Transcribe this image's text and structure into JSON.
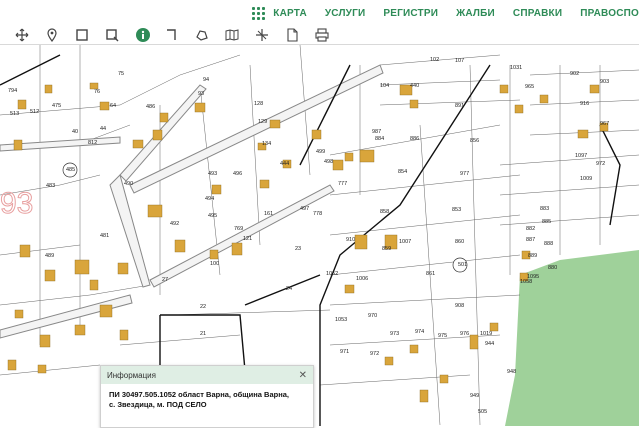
{
  "nav": {
    "items": [
      "КАРТА",
      "УСЛУГИ",
      "РЕГИСТРИ",
      "ЖАЛБИ",
      "СПРАВКИ",
      "ПРАВОСПО"
    ]
  },
  "toolbar": {
    "tools": [
      "move-icon",
      "pin-icon",
      "select-rect-icon",
      "select-poly-icon",
      "info-icon",
      "measure-angle-icon",
      "polygon-icon",
      "map-icon",
      "split-icon",
      "document-icon",
      "print-icon"
    ]
  },
  "map": {
    "parcel_labels": [
      "794",
      "475",
      "513",
      "512",
      "812",
      "40",
      "44",
      "75",
      "76",
      "64",
      "486",
      "93",
      "94",
      "128",
      "129",
      "134",
      "1031",
      "102",
      "107",
      "104",
      "440",
      "903",
      "902",
      "965",
      "916",
      "967",
      "891",
      "1097",
      "856",
      "854",
      "977",
      "858",
      "853",
      "859",
      "860",
      "861",
      "908",
      "910",
      "1007",
      "1006",
      "1052",
      "1053",
      "970",
      "971",
      "972",
      "973",
      "974",
      "975",
      "976",
      "1019",
      "944",
      "948",
      "949",
      "505",
      "501",
      "485",
      "483",
      "481",
      "489",
      "490",
      "492",
      "493",
      "494",
      "495",
      "496",
      "497",
      "498",
      "499",
      "444",
      "161",
      "769",
      "121",
      "100",
      "27",
      "22",
      "21",
      "23",
      "24",
      "778",
      "777",
      "987",
      "884",
      "886",
      "882",
      "883",
      "885",
      "887",
      "888",
      "889",
      "880",
      "1095",
      "1058",
      "1009",
      "972"
    ],
    "brand_colors": {
      "nav": "#2e8b57",
      "park": "#9fd19a",
      "building": "#d9a53b"
    }
  },
  "popup": {
    "title": "Информация",
    "line1": "ПИ 30497.505.1052 област Варна, община Варна,",
    "line2": "с. Звездица, м. ПОД СЕЛО"
  }
}
